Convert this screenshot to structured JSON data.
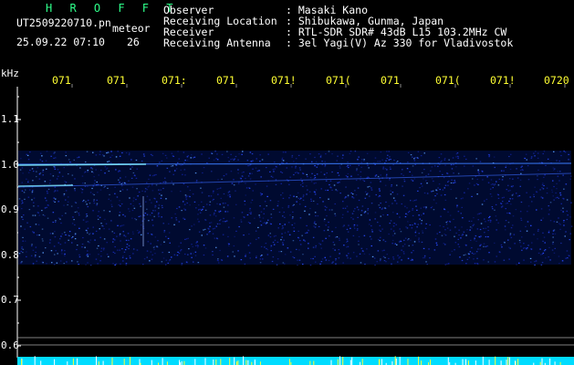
{
  "app": {
    "brand": "H R O F F T",
    "filename": "UT2509220710.pn",
    "type_label": "meteor",
    "date_time": "25.09.22 07:10",
    "count": "26"
  },
  "info": {
    "labels": [
      "Observer",
      "Receiving Location",
      "Receiver",
      "Receiving Antenna"
    ],
    "values": [
      ": Masaki Kano",
      ": Shibukawa, Gunma, Japan",
      ": RTL-SDR SDR# 43dB L15 103.2MHz CW",
      ": 3el Yagi(V) Az 330 for Vladivostok"
    ]
  },
  "axis": {
    "unit": "kHz",
    "y_ticks": [
      "1.1",
      "1.0",
      "0.9",
      "0.8",
      "0.7",
      "0.6"
    ],
    "minute_labels": [
      "071",
      "071",
      "071:",
      "071",
      "071!",
      "071(",
      "071",
      "071(",
      "071!",
      "0720"
    ]
  },
  "colors": {
    "background": "#000000",
    "signal": "#2040ff",
    "minute_text": "#ffff33",
    "brand_text": "#2eff8a",
    "meter_cyan": "#00ffff"
  }
}
